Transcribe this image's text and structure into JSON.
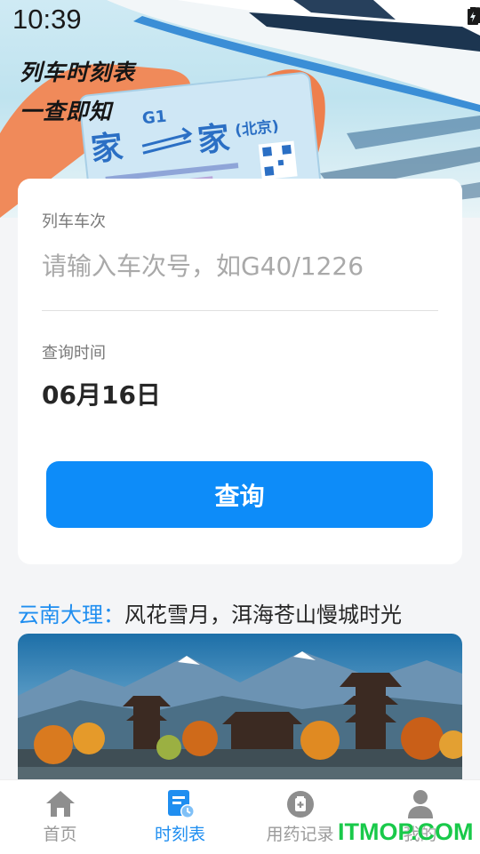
{
  "status_bar": {
    "time": "10:39"
  },
  "hero": {
    "title_line1": "列车时刻表",
    "title_line2": "一查即知",
    "ticket": {
      "train_code": "G1",
      "from": "家",
      "to": "家",
      "to_note": "(北京)"
    }
  },
  "search_card": {
    "train_label": "列车车次",
    "train_placeholder": "请输入车次号，如G40/1226",
    "train_value": "",
    "date_label": "查询时间",
    "date_value": "06月16日",
    "query_button": "查询"
  },
  "promo": {
    "place": "云南大理",
    "separator": "：",
    "tagline": "风花雪月，洱海苍山慢城时光"
  },
  "bottom_nav": {
    "items": [
      {
        "label": "首页",
        "icon": "home-icon",
        "active": false
      },
      {
        "label": "时刻表",
        "icon": "timetable-icon",
        "active": true
      },
      {
        "label": "用药记录",
        "icon": "medicine-icon",
        "active": false
      },
      {
        "label": "我的",
        "icon": "user-icon",
        "active": false
      }
    ]
  },
  "watermark": "ITMOP.COM",
  "colors": {
    "accent": "#1f8ef0",
    "button": "#0d8cf9",
    "watermark": "#19c94a"
  }
}
